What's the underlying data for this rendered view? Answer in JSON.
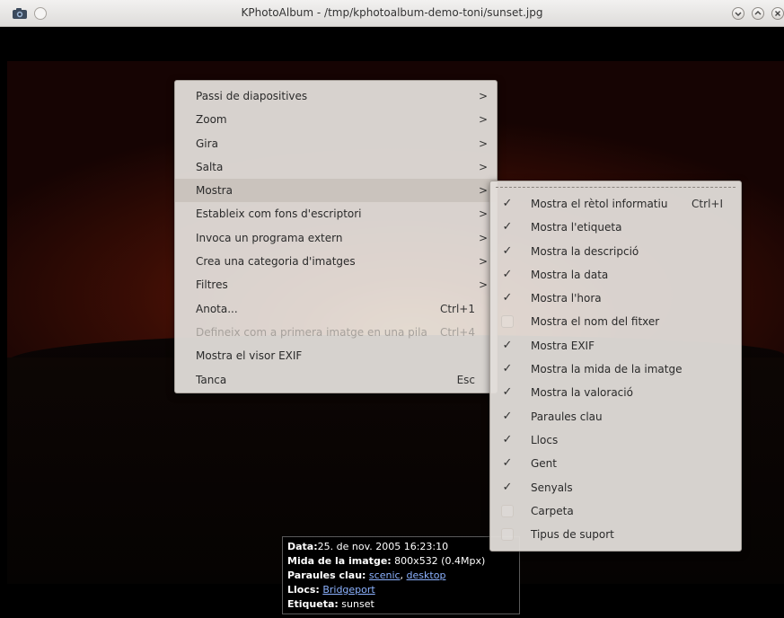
{
  "window": {
    "title": "KPhotoAlbum - /tmp/kphotoalbum-demo-toni/sunset.jpg",
    "buttons": [
      "minimize-icon",
      "maximize-icon",
      "close-icon"
    ]
  },
  "context_menu": {
    "items": [
      {
        "label": "Passi de diapositives",
        "submenu": true
      },
      {
        "label": "Zoom",
        "submenu": true
      },
      {
        "label": "Gira",
        "submenu": true
      },
      {
        "label": "Salta",
        "submenu": true
      },
      {
        "label": "Mostra",
        "submenu": true,
        "active": true
      },
      {
        "label": "Estableix com fons d'escriptori",
        "submenu": true
      },
      {
        "label": "Invoca un programa extern",
        "submenu": true
      },
      {
        "label": "Crea una categoria d'imatges",
        "submenu": true
      },
      {
        "label": "Filtres",
        "submenu": true
      },
      {
        "label": "Anota...",
        "shortcut": "Ctrl+1"
      },
      {
        "label": "Defineix com a primera imatge en una pila",
        "shortcut": "Ctrl+4",
        "disabled": true
      },
      {
        "label": "Mostra el visor EXIF"
      },
      {
        "label": "Tanca",
        "shortcut": "Esc"
      }
    ],
    "arrow": ">"
  },
  "show_submenu": {
    "items": [
      {
        "label": "Mostra el rètol informatiu",
        "checked": true,
        "shortcut": "Ctrl+I"
      },
      {
        "label": "Mostra l'etiqueta",
        "checked": true
      },
      {
        "label": "Mostra la descripció",
        "checked": true
      },
      {
        "label": "Mostra la data",
        "checked": true
      },
      {
        "label": "Mostra l'hora",
        "checked": true
      },
      {
        "label": "Mostra el nom del fitxer",
        "checked": false
      },
      {
        "label": "Mostra EXIF",
        "checked": true
      },
      {
        "label": "Mostra la mida de la imatge",
        "checked": true
      },
      {
        "label": "Mostra la valoració",
        "checked": true
      },
      {
        "label": "Paraules clau",
        "checked": true
      },
      {
        "label": "Llocs",
        "checked": true
      },
      {
        "label": "Gent",
        "checked": true
      },
      {
        "label": "Senyals",
        "checked": true
      },
      {
        "label": "Carpeta",
        "checked": false
      },
      {
        "label": "Tipus de suport",
        "checked": false
      }
    ],
    "check_glyph": "✓"
  },
  "info": {
    "date_label": "Data:",
    "date_value": "25. de nov. 2005 16:23:10",
    "size_label": "Mida de la imatge:",
    "size_value": " 800x532 (0.4Mpx)",
    "keywords_label": "Paraules clau:",
    "keyword1": "scenic",
    "separator": ", ",
    "keyword2": "desktop",
    "places_label": "Llocs:",
    "place1": "Bridgeport",
    "tag_label": "Etiqueta:",
    "tag_value": " sunset"
  }
}
